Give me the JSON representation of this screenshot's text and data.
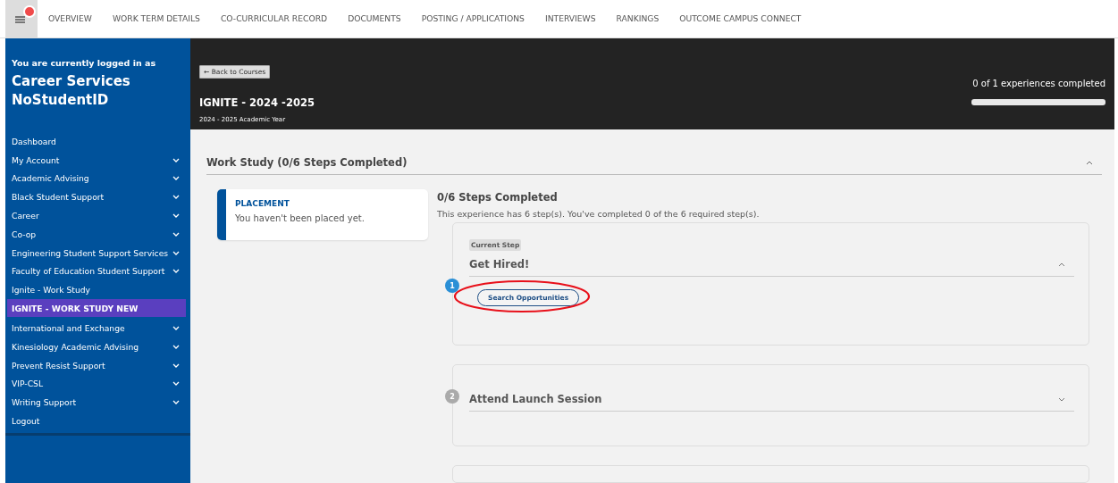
{
  "top_nav": {
    "notification_dot": true,
    "tabs": [
      {
        "label": "OVERVIEW",
        "selected": false
      },
      {
        "label": "WORK TERM DETAILS",
        "selected": false
      },
      {
        "label": "CO-CURRICULAR RECORD",
        "selected": false
      },
      {
        "label": "DOCUMENTS",
        "selected": false
      },
      {
        "label": "POSTING / APPLICATIONS",
        "selected": false
      },
      {
        "label": "INTERVIEWS",
        "selected": false
      },
      {
        "label": "RANKINGS",
        "selected": false
      },
      {
        "label": "OUTCOME CAMPUS CONNECT",
        "selected": false
      }
    ]
  },
  "sidebar": {
    "login_note": "You are currently logged in as",
    "user_name": "Career Services NoStudentID",
    "items": [
      {
        "label": "Dashboard",
        "expandable": false,
        "selected": false
      },
      {
        "label": "My Account",
        "expandable": true,
        "selected": false
      },
      {
        "label": "Academic Advising",
        "expandable": true,
        "selected": false
      },
      {
        "label": "Black Student Support",
        "expandable": true,
        "selected": false
      },
      {
        "label": "Career",
        "expandable": true,
        "selected": false
      },
      {
        "label": "Co-op",
        "expandable": true,
        "selected": false
      },
      {
        "label": "Engineering Student Support Services",
        "expandable": true,
        "selected": false
      },
      {
        "label": "Faculty of Education Student Support",
        "expandable": true,
        "selected": false
      },
      {
        "label": "Ignite - Work Study",
        "expandable": false,
        "selected": false
      },
      {
        "label": "IGNITE - WORK STUDY NEW",
        "expandable": false,
        "selected": true
      },
      {
        "label": "International and Exchange",
        "expandable": true,
        "selected": false
      },
      {
        "label": "Kinesiology Academic Advising",
        "expandable": true,
        "selected": false
      },
      {
        "label": "Prevent Resist Support",
        "expandable": true,
        "selected": false
      },
      {
        "label": "VIP-CSL",
        "expandable": true,
        "selected": false
      },
      {
        "label": "Writing Support",
        "expandable": true,
        "selected": false
      },
      {
        "label": "Logout",
        "expandable": false,
        "selected": false
      }
    ]
  },
  "header": {
    "back_button": "← Back to Courses",
    "title": "IGNITE - 2024 -2025",
    "subtitle": "2024 - 2025 Academic Year",
    "progress_text": "0 of 1 experiences completed",
    "progress": {
      "level": 0
    }
  },
  "section": {
    "title": "Work Study (0/6 Steps Completed)",
    "expanded": true,
    "placement": {
      "label": "PLACEMENT",
      "text": "You haven't been placed yet."
    },
    "steps_heading": "0/6 Steps Completed",
    "steps_summary": "This experience has 6 step(s). You've completed 0 of the 6 required step(s).",
    "steps": [
      {
        "number": "1",
        "current": true,
        "tag": "Current Step",
        "title": "Get Hired!",
        "expanded": true,
        "actions": [
          "Search Opportunities"
        ],
        "highlighted": true
      },
      {
        "number": "2",
        "current": false,
        "title": "Attend Launch Session",
        "expanded": false
      }
    ]
  }
}
